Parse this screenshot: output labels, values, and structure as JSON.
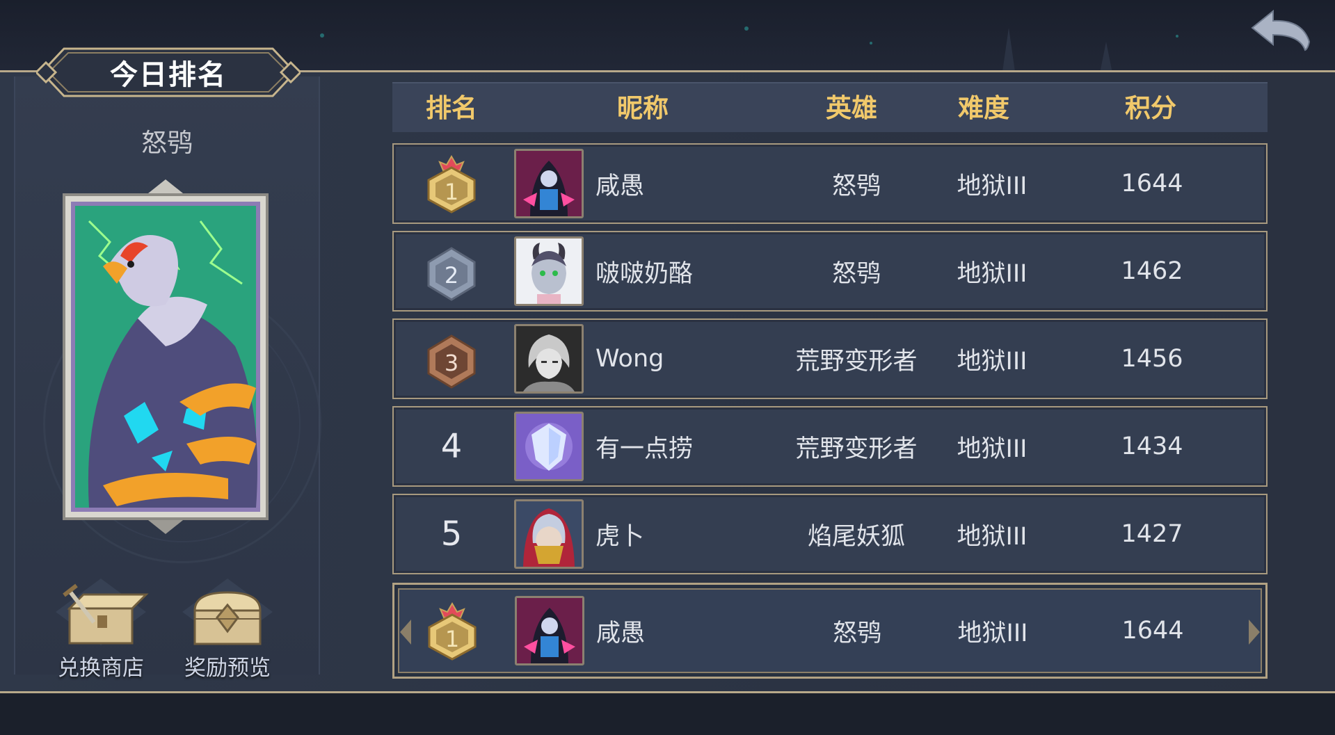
{
  "header": {
    "title": "今日排名",
    "back_icon": "back-arrow-icon"
  },
  "hero_panel": {
    "hero_name": "怒鸮",
    "card_icon": "thunder-raven-hero-card"
  },
  "actions": {
    "shop_label": "兑换商店",
    "shop_icon": "treasure-chest-sword-icon",
    "reward_label": "奖励预览",
    "reward_icon": "treasure-chest-icon"
  },
  "table": {
    "columns": [
      "排名",
      "昵称",
      "英雄",
      "难度",
      "积分"
    ],
    "rows": [
      {
        "rank": "1",
        "medal": "gold",
        "avatar": "dark-sorceress-avatar",
        "nickname": "咸愚",
        "hero": "怒鸮",
        "difficulty": "地狱III",
        "score": "1644"
      },
      {
        "rank": "2",
        "medal": "silver",
        "avatar": "horned-demon-girl-avatar",
        "nickname": "啵啵奶酪",
        "hero": "怒鸮",
        "difficulty": "地狱III",
        "score": "1462"
      },
      {
        "rank": "3",
        "medal": "bronze",
        "avatar": "silver-haired-warrior-avatar",
        "nickname": "Wong",
        "hero": "荒野变形者",
        "difficulty": "地狱III",
        "score": "1456"
      },
      {
        "rank": "4",
        "medal": "",
        "avatar": "crystal-shield-avatar",
        "nickname": "有一点捞",
        "hero": "荒野变形者",
        "difficulty": "地狱III",
        "score": "1434"
      },
      {
        "rank": "5",
        "medal": "",
        "avatar": "masked-rogue-avatar",
        "nickname": "虎卜",
        "hero": "焰尾妖狐",
        "difficulty": "地狱III",
        "score": "1427"
      }
    ],
    "my_row": {
      "rank": "1",
      "medal": "gold",
      "avatar": "dark-sorceress-avatar",
      "nickname": "咸愚",
      "hero": "怒鸮",
      "difficulty": "地狱III",
      "score": "1644"
    }
  },
  "colors": {
    "header_text": "#f1c96b",
    "row_border": "#a89a7f",
    "gold": "#e7c878",
    "silver": "#8e9bb0",
    "bronze": "#b07a5a"
  }
}
